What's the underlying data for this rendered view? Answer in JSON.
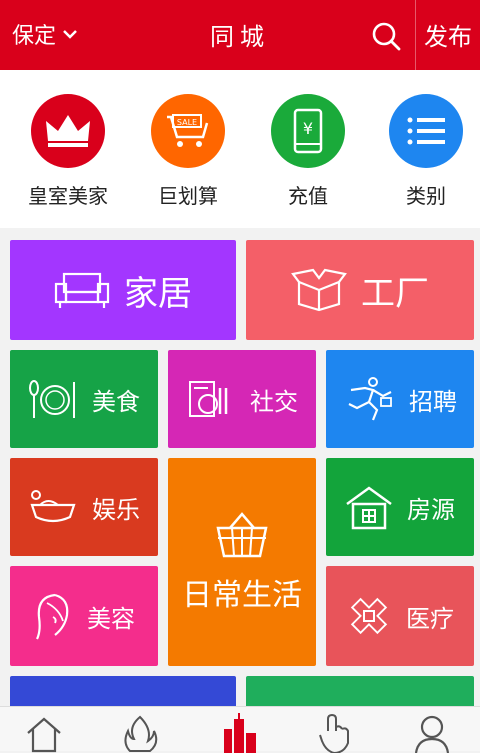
{
  "header": {
    "city": "保定",
    "title": "同城",
    "publish": "发布"
  },
  "quick": [
    {
      "label": "皇室美家",
      "color": "#d9001b",
      "icon": "crown-icon"
    },
    {
      "label": "巨划算",
      "color": "#ff6600",
      "icon": "sale-cart-icon"
    },
    {
      "label": "充值",
      "color": "#1aaa3a",
      "icon": "phone-yuan-icon"
    },
    {
      "label": "类别",
      "color": "#1e86f0",
      "icon": "list-icon"
    }
  ],
  "tiles": {
    "home": {
      "label": "家居",
      "color": "#a336ff"
    },
    "factory": {
      "label": "工厂",
      "color": "#f45f68"
    },
    "food": {
      "label": "美食",
      "color": "#16a347"
    },
    "social": {
      "label": "社交",
      "color": "#d527b5"
    },
    "jobs": {
      "label": "招聘",
      "color": "#1e86f0"
    },
    "fun": {
      "label": "娱乐",
      "color": "#d93a1f"
    },
    "life": {
      "label": "日常生活",
      "color": "#f47a00"
    },
    "house": {
      "label": "房源",
      "color": "#13a43b"
    },
    "beauty": {
      "label": "美容",
      "color": "#f42d8c"
    },
    "medical": {
      "label": "医疗",
      "color": "#e8545a"
    },
    "more1": {
      "color": "#3449d6"
    },
    "more2": {
      "color": "#1fae5c"
    }
  },
  "tabs": [
    "home-icon",
    "flame-icon",
    "city-icon",
    "touch-icon",
    "user-icon"
  ]
}
